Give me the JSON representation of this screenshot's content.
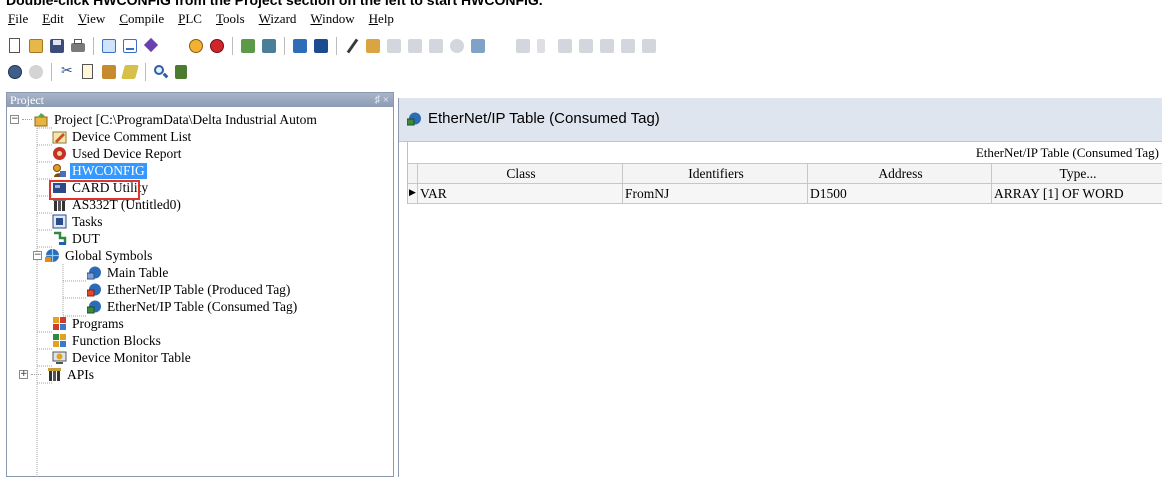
{
  "caption": "Double-click HWCONFIG from the Project section on the left to start HWCONFIG.",
  "menu": [
    "File",
    "Edit",
    "View",
    "Compile",
    "PLC",
    "Tools",
    "Wizard",
    "Window",
    "Help"
  ],
  "project_pane": {
    "title": "Project",
    "pin_glyph": "♯ ×",
    "tree": {
      "root": "Project [C:\\ProgramData\\Delta Industrial Autom",
      "device_comment_list": "Device Comment List",
      "used_device_report": "Used Device Report",
      "hwconfig": "HWCONFIG",
      "card_utility": "CARD Utility",
      "as332t": "AS332T  (Untitled0)",
      "tasks": "Tasks",
      "dut": "DUT",
      "global_symbols": "Global Symbols",
      "main_table": "Main Table",
      "eip_produced": "EtherNet/IP Table (Produced Tag)",
      "eip_consumed": "EtherNet/IP Table (Consumed Tag)",
      "programs": "Programs",
      "function_blocks": "Function Blocks",
      "device_monitor_table": "Device Monitor Table",
      "apis": "APIs"
    }
  },
  "main": {
    "tab_title": "EtherNet/IP Table (Consumed Tag)",
    "group_header": "EtherNet/IP Table (Consumed Tag)",
    "columns": [
      "Class",
      "Identifiers",
      "Address",
      "Type..."
    ],
    "rows": [
      {
        "indicator": "▶",
        "class": "VAR",
        "identifier": "FromNJ",
        "address": "D1500",
        "type": "ARRAY [1] OF WORD"
      }
    ]
  },
  "colors": {
    "selection": "#3399ff",
    "highlight_box": "#e0332c",
    "tab_bar": "#dfe5ee",
    "pane_title": "#8c9bb3"
  }
}
